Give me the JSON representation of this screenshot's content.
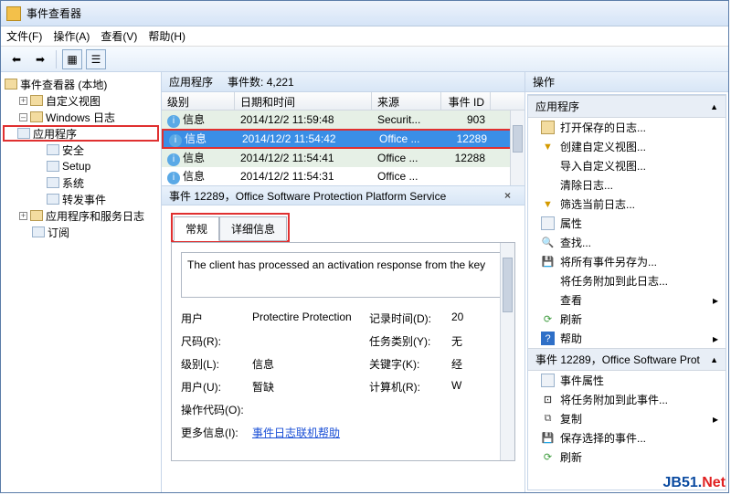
{
  "window": {
    "title": "事件查看器"
  },
  "menu": {
    "file": "文件(F)",
    "action": "操作(A)",
    "view": "查看(V)",
    "help": "帮助(H)"
  },
  "tree": {
    "root": "事件查看器 (本地)",
    "custom_views": "自定义视图",
    "windows_logs": "Windows 日志",
    "application": "应用程序",
    "security": "安全",
    "setup": "Setup",
    "system": "系统",
    "forwarded": "转发事件",
    "apps_services": "应用程序和服务日志",
    "subscriptions": "订阅"
  },
  "mid_header": {
    "app": "应用程序",
    "count_label": "事件数:",
    "count": "4,221"
  },
  "columns": {
    "level": "级别",
    "datetime": "日期和时间",
    "source": "来源",
    "eventid": "事件 ID"
  },
  "rows": [
    {
      "level": "信息",
      "datetime": "2014/12/2 11:59:48",
      "source": "Securit...",
      "id": "903",
      "alt": true
    },
    {
      "level": "信息",
      "datetime": "2014/12/2 11:54:42",
      "source": "Office ...",
      "id": "12289",
      "sel": true
    },
    {
      "level": "信息",
      "datetime": "2014/12/2 11:54:41",
      "source": "Office ...",
      "id": "12288",
      "alt": true
    },
    {
      "level": "信息",
      "datetime": "2014/12/2 11:54:31",
      "source": "Office ...",
      "id": "",
      "alt": false
    }
  ],
  "detail": {
    "title": "事件 12289，Office Software Protection Platform Service",
    "tab_general": "常规",
    "tab_details": "详细信息",
    "message": "The client has processed an activation response from the key",
    "fields": {
      "user_l": "用户",
      "user_v": "Protectire Protection",
      "logtime_l": "记录时间(D):",
      "logtime_v": "20",
      "rc_l": "尺码(R):",
      "rc_v": "",
      "taskcat_l": "任务类别(Y):",
      "taskcat_v": "无",
      "level_l": "级别(L):",
      "level_v": "信息",
      "keyword_l": "关键字(K):",
      "keyword_v": "经",
      "useru_l": "用户(U):",
      "useru_v": "暂缺",
      "computer_l": "计算机(R):",
      "computer_v": "W",
      "opcode_l": "操作代码(O):",
      "opcode_v": "",
      "moreinfo_l": "更多信息(I):",
      "moreinfo_link": "事件日志联机帮助"
    }
  },
  "actions": {
    "title": "操作",
    "section1": "应用程序",
    "open_saved": "打开保存的日志...",
    "create_view": "创建自定义视图...",
    "import_view": "导入自定义视图...",
    "clear_log": "清除日志...",
    "filter_log": "筛选当前日志...",
    "properties": "属性",
    "find": "查找...",
    "save_all": "将所有事件另存为...",
    "attach_task_log": "将任务附加到此日志...",
    "view": "查看",
    "refresh": "刷新",
    "help": "帮助",
    "section2": "事件 12289，Office Software Prot...",
    "event_props": "事件属性",
    "attach_task_event": "将任务附加到此事件...",
    "copy": "复制",
    "save_selected": "保存选择的事件...",
    "refresh2": "刷新"
  },
  "watermark": {
    "a": "JB51.",
    "b": "Net"
  }
}
